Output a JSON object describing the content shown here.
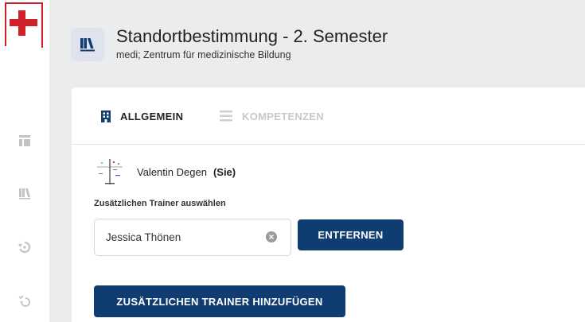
{
  "header": {
    "title": "Standortbestimmung - 2. Semester",
    "subtitle": "medi; Zentrum für medizinische Bildung"
  },
  "sidebar": {
    "items": [
      {
        "icon": "dashboard-icon"
      },
      {
        "icon": "library-icon"
      },
      {
        "icon": "history-icon"
      },
      {
        "icon": "check-history-icon"
      }
    ]
  },
  "tabs": [
    {
      "label": "ALLGEMEIN",
      "active": true
    },
    {
      "label": "KOMPETENZEN",
      "active": false
    }
  ],
  "trainer": {
    "name": "Valentin Degen",
    "you_label": "(Sie)"
  },
  "additional_trainer": {
    "label": "Zusätzlichen Trainer auswählen",
    "value": "Jessica Thönen",
    "remove_label": "ENTFERNEN",
    "add_label": "ZUSÄTZLICHEN TRAINER HINZUFÜGEN"
  },
  "colors": {
    "accent": "#0f3d72",
    "brand_red": "#d0202a",
    "background": "#ebecee"
  }
}
